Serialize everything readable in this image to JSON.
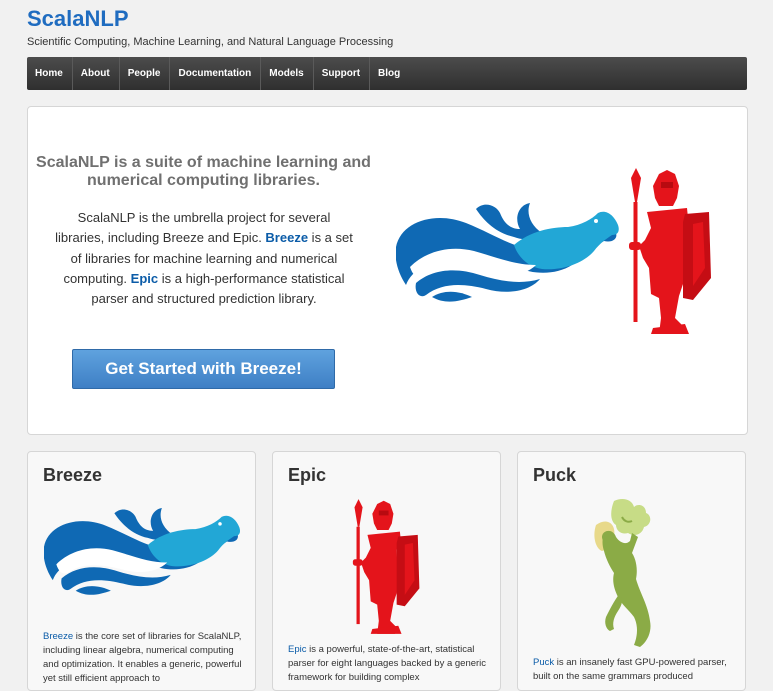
{
  "site": {
    "title": "ScalaNLP",
    "subtitle": "Scientific Computing, Machine Learning, and Natural Language Processing"
  },
  "nav": [
    "Home",
    "About",
    "People",
    "Documentation",
    "Models",
    "Support",
    "Blog"
  ],
  "hero": {
    "heading": "ScalaNLP is a suite of machine learning and numerical computing libraries.",
    "text_1": "ScalaNLP is the umbrella project for several libraries, including Breeze and Epic. ",
    "link_breeze": "Breeze",
    "text_2": " is a set of libraries for machine learning and numerical computing. ",
    "link_epic": "Epic",
    "text_3": " is a high-performance statistical parser and structured prediction library.",
    "cta": "Get Started with Breeze!"
  },
  "cards": [
    {
      "title": "Breeze",
      "link": "Breeze",
      "desc": " is the core set of libraries for ScalaNLP, including linear algebra, numerical computing and optimization. It enables a generic, powerful yet still efficient approach to"
    },
    {
      "title": "Epic",
      "link": "Epic",
      "desc": " is a powerful, state-of-the-art, statistical parser for eight languages backed by a generic framework for building complex"
    },
    {
      "title": "Puck",
      "link": "Puck",
      "desc": " is an insanely fast GPU-powered parser, built on the same grammars produced"
    }
  ],
  "colors": {
    "brand": "#1f6cc0",
    "wave_dark": "#0f69b4",
    "wave_light": "#22a7d6",
    "epic_red": "#e4141b",
    "puck_green": "#8bab46"
  },
  "icons": {
    "hero_left": "breeze-wave-dog-icon",
    "hero_right": "epic-knight-icon",
    "puck": "puck-fairy-icon"
  }
}
